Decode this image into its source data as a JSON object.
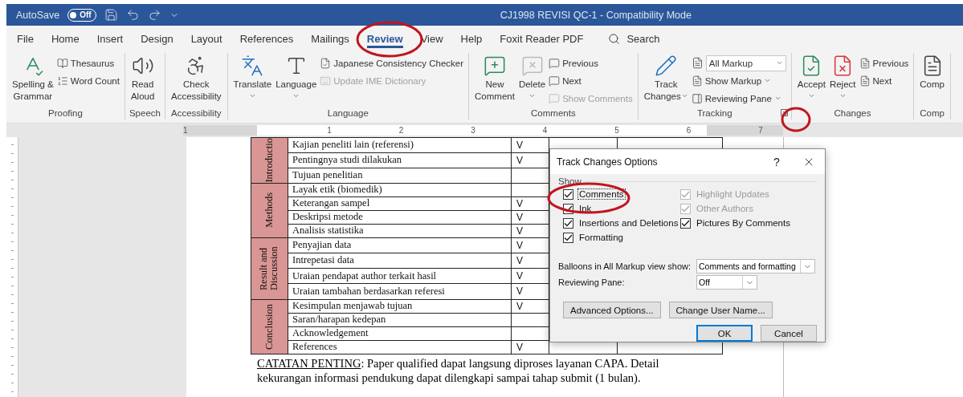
{
  "title_bar": {
    "autosave_label": "AutoSave",
    "autosave": {
      "label": "Off",
      "on": false
    },
    "title": "CJ1998 REVISI QC-1 - Compatibility Mode"
  },
  "tabs": [
    {
      "label": "File",
      "selected": false
    },
    {
      "label": "Home",
      "selected": false
    },
    {
      "label": "Insert",
      "selected": false
    },
    {
      "label": "Design",
      "selected": false
    },
    {
      "label": "Layout",
      "selected": false
    },
    {
      "label": "References",
      "selected": false
    },
    {
      "label": "Mailings",
      "selected": false
    },
    {
      "label": "Review",
      "selected": true
    },
    {
      "label": "View",
      "selected": false
    },
    {
      "label": "Help",
      "selected": false
    },
    {
      "label": "Foxit Reader PDF",
      "selected": false
    }
  ],
  "search": {
    "label": "Search"
  },
  "ribbon": {
    "groups": [
      {
        "label": "Proofing",
        "launcher": false,
        "items": [
          {
            "kind": "large",
            "lines": [
              "Spelling &",
              "Grammar"
            ],
            "caret": false,
            "disabled": false
          },
          {
            "kind": "stack",
            "buttons": [
              {
                "kind": "button",
                "label": "Thesaurus",
                "caret": false,
                "disabled": false
              },
              {
                "kind": "button",
                "label": "Word Count",
                "caret": false,
                "disabled": false
              }
            ]
          }
        ]
      },
      {
        "label": "Speech",
        "launcher": false,
        "items": [
          {
            "kind": "large",
            "lines": [
              "Read",
              "Aloud"
            ],
            "caret": false,
            "disabled": false
          }
        ]
      },
      {
        "label": "Accessibility",
        "launcher": false,
        "items": [
          {
            "kind": "large",
            "lines": [
              "Check",
              "Accessibility"
            ],
            "caret": false,
            "disabled": false
          }
        ]
      },
      {
        "label": "Language",
        "launcher": false,
        "items": [
          {
            "kind": "large",
            "lines": [
              "Translate"
            ],
            "caret": true,
            "disabled": false
          },
          {
            "kind": "large",
            "lines": [
              "Language"
            ],
            "caret": true,
            "disabled": false
          },
          {
            "kind": "stack",
            "buttons": [
              {
                "kind": "button",
                "label": "Japanese Consistency Checker",
                "caret": false,
                "disabled": false
              },
              {
                "kind": "button",
                "label": "Update IME Dictionary",
                "caret": false,
                "disabled": true
              }
            ]
          }
        ]
      },
      {
        "label": "Comments",
        "launcher": false,
        "items": [
          {
            "kind": "large",
            "lines": [
              "New",
              "Comment"
            ],
            "caret": false,
            "disabled": false
          },
          {
            "kind": "large",
            "lines": [
              "Delete"
            ],
            "caret": true,
            "disabled": false
          },
          {
            "kind": "stack",
            "buttons": [
              {
                "kind": "button",
                "label": "Previous",
                "caret": false,
                "disabled": false
              },
              {
                "kind": "button",
                "label": "Next",
                "caret": false,
                "disabled": false
              },
              {
                "kind": "button",
                "label": "Show Comments",
                "caret": false,
                "disabled": true
              }
            ]
          }
        ]
      },
      {
        "label": "Tracking",
        "launcher": true,
        "items": [
          {
            "kind": "large",
            "lines": [
              "Track",
              "Changes"
            ],
            "caret": true,
            "disabled": false
          },
          {
            "kind": "stack",
            "buttons": [
              {
                "kind": "combo",
                "label": "All Markup",
                "caret": true,
                "disabled": false
              },
              {
                "kind": "button",
                "label": "Show Markup",
                "caret": true,
                "disabled": false
              },
              {
                "kind": "button",
                "label": "Reviewing Pane",
                "caret": true,
                "disabled": false
              }
            ]
          }
        ]
      },
      {
        "label": "Changes",
        "launcher": false,
        "items": [
          {
            "kind": "large",
            "lines": [
              "Accept"
            ],
            "caret": true,
            "disabled": false
          },
          {
            "kind": "large",
            "lines": [
              "Reject"
            ],
            "caret": true,
            "disabled": false
          },
          {
            "kind": "stack",
            "buttons": [
              {
                "kind": "button",
                "label": "Previous",
                "caret": false,
                "disabled": false
              },
              {
                "kind": "button",
                "label": "Next",
                "caret": false,
                "disabled": false
              }
            ]
          }
        ]
      },
      {
        "label": "Comp",
        "launcher": false,
        "items": [
          {
            "kind": "large",
            "lines": [
              "Comp"
            ],
            "caret": false,
            "disabled": false
          }
        ]
      }
    ]
  },
  "ruler": {
    "marks": [
      "1",
      "1",
      "2",
      "3",
      "4",
      "5",
      "6",
      "7"
    ]
  },
  "document": {
    "table": {
      "sections": [
        {
          "label": "Introductio",
          "rows": [
            {
              "item": "Kajian peneliti lain (referensi)",
              "mark": "V"
            },
            {
              "item": "Pentingnya studi dilakukan",
              "mark": "V"
            },
            {
              "item": "Tujuan penelitian"
            }
          ]
        },
        {
          "label": "Methods",
          "rows": [
            {
              "item": "Layak etik (biomedik)"
            },
            {
              "item": "Keterangan sampel",
              "mark": "V"
            },
            {
              "item": "Deskripsi metode",
              "mark": "V"
            },
            {
              "item": "Analisis statistika",
              "mark": "V"
            }
          ]
        },
        {
          "label": "Result and Discussion",
          "rows": [
            {
              "item": "Penyajian data",
              "mark": "V"
            },
            {
              "item": "Intrepetasi data",
              "mark": "V"
            },
            {
              "item": "Uraian pendapat author terkait hasil",
              "mark": "V"
            },
            {
              "item": "Uraian tambahan berdasarkan referesi",
              "mark": "V"
            }
          ]
        },
        {
          "label": "Conclusion",
          "rows": [
            {
              "item": "Kesimpulan menjawab tujuan",
              "mark": "V"
            },
            {
              "item": "Saran/harapan kedepan"
            },
            {
              "item": "Acknowledgement"
            },
            {
              "item": "References",
              "mark": "V"
            }
          ]
        }
      ]
    },
    "note": {
      "lead": "CATATAN PENTING",
      "lines": [
        ": Paper qualified dapat langsung diproses layanan CAPA. Detail",
        "kekurangan informasi pendukung dapat dilengkapi sampai tahap submit (1 bulan)."
      ]
    }
  },
  "dialog": {
    "title": "Track Changes Options",
    "help": "?",
    "show_label": "Show",
    "checkboxes": [
      {
        "label": "Comments",
        "checked": true,
        "disabled": false,
        "focused": true
      },
      {
        "label": "Highlight Updates",
        "checked": true,
        "disabled": true,
        "focused": false
      },
      {
        "label": "Ink",
        "checked": true,
        "disabled": false,
        "focused": false
      },
      {
        "label": "Other Authors",
        "checked": true,
        "disabled": true,
        "focused": false
      },
      {
        "label": "Insertions and Deletions",
        "checked": true,
        "disabled": false,
        "focused": false
      },
      {
        "label": "Pictures By Comments",
        "checked": true,
        "disabled": false,
        "focused": false
      },
      {
        "label": "Formatting",
        "checked": true,
        "disabled": false,
        "focused": false
      }
    ],
    "selects": [
      {
        "label": "Balloons in All Markup view show:",
        "value": "Comments and formatting"
      },
      {
        "label": "Reviewing Pane:",
        "value": "Off"
      }
    ],
    "option_buttons": [
      {
        "label": "Advanced Options...",
        "default": false
      },
      {
        "label": "Change User Name...",
        "default": false
      }
    ],
    "footer_buttons": [
      {
        "label": "OK",
        "default": true
      },
      {
        "label": "Cancel",
        "default": false
      }
    ]
  }
}
